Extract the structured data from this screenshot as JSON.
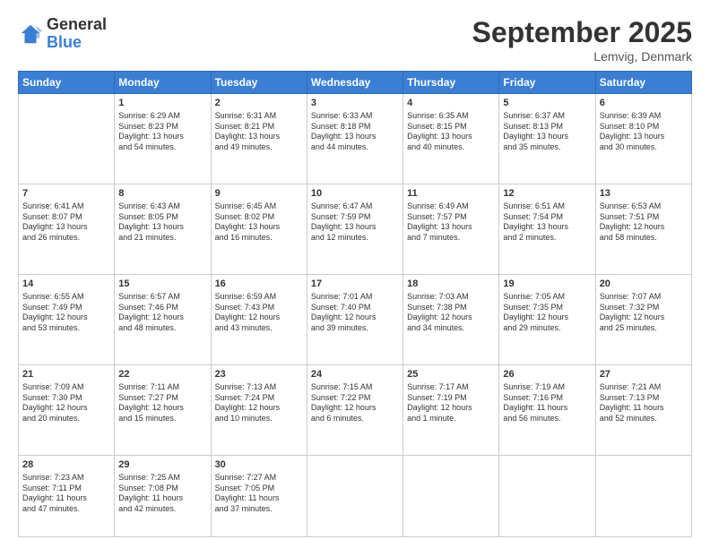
{
  "header": {
    "logo_general": "General",
    "logo_blue": "Blue",
    "month_title": "September 2025",
    "location": "Lemvig, Denmark"
  },
  "days_of_week": [
    "Sunday",
    "Monday",
    "Tuesday",
    "Wednesday",
    "Thursday",
    "Friday",
    "Saturday"
  ],
  "weeks": [
    [
      {
        "day": "",
        "content": ""
      },
      {
        "day": "1",
        "content": "Sunrise: 6:29 AM\nSunset: 8:23 PM\nDaylight: 13 hours\nand 54 minutes."
      },
      {
        "day": "2",
        "content": "Sunrise: 6:31 AM\nSunset: 8:21 PM\nDaylight: 13 hours\nand 49 minutes."
      },
      {
        "day": "3",
        "content": "Sunrise: 6:33 AM\nSunset: 8:18 PM\nDaylight: 13 hours\nand 44 minutes."
      },
      {
        "day": "4",
        "content": "Sunrise: 6:35 AM\nSunset: 8:15 PM\nDaylight: 13 hours\nand 40 minutes."
      },
      {
        "day": "5",
        "content": "Sunrise: 6:37 AM\nSunset: 8:13 PM\nDaylight: 13 hours\nand 35 minutes."
      },
      {
        "day": "6",
        "content": "Sunrise: 6:39 AM\nSunset: 8:10 PM\nDaylight: 13 hours\nand 30 minutes."
      }
    ],
    [
      {
        "day": "7",
        "content": "Sunrise: 6:41 AM\nSunset: 8:07 PM\nDaylight: 13 hours\nand 26 minutes."
      },
      {
        "day": "8",
        "content": "Sunrise: 6:43 AM\nSunset: 8:05 PM\nDaylight: 13 hours\nand 21 minutes."
      },
      {
        "day": "9",
        "content": "Sunrise: 6:45 AM\nSunset: 8:02 PM\nDaylight: 13 hours\nand 16 minutes."
      },
      {
        "day": "10",
        "content": "Sunrise: 6:47 AM\nSunset: 7:59 PM\nDaylight: 13 hours\nand 12 minutes."
      },
      {
        "day": "11",
        "content": "Sunrise: 6:49 AM\nSunset: 7:57 PM\nDaylight: 13 hours\nand 7 minutes."
      },
      {
        "day": "12",
        "content": "Sunrise: 6:51 AM\nSunset: 7:54 PM\nDaylight: 13 hours\nand 2 minutes."
      },
      {
        "day": "13",
        "content": "Sunrise: 6:53 AM\nSunset: 7:51 PM\nDaylight: 12 hours\nand 58 minutes."
      }
    ],
    [
      {
        "day": "14",
        "content": "Sunrise: 6:55 AM\nSunset: 7:49 PM\nDaylight: 12 hours\nand 53 minutes."
      },
      {
        "day": "15",
        "content": "Sunrise: 6:57 AM\nSunset: 7:46 PM\nDaylight: 12 hours\nand 48 minutes."
      },
      {
        "day": "16",
        "content": "Sunrise: 6:59 AM\nSunset: 7:43 PM\nDaylight: 12 hours\nand 43 minutes."
      },
      {
        "day": "17",
        "content": "Sunrise: 7:01 AM\nSunset: 7:40 PM\nDaylight: 12 hours\nand 39 minutes."
      },
      {
        "day": "18",
        "content": "Sunrise: 7:03 AM\nSunset: 7:38 PM\nDaylight: 12 hours\nand 34 minutes."
      },
      {
        "day": "19",
        "content": "Sunrise: 7:05 AM\nSunset: 7:35 PM\nDaylight: 12 hours\nand 29 minutes."
      },
      {
        "day": "20",
        "content": "Sunrise: 7:07 AM\nSunset: 7:32 PM\nDaylight: 12 hours\nand 25 minutes."
      }
    ],
    [
      {
        "day": "21",
        "content": "Sunrise: 7:09 AM\nSunset: 7:30 PM\nDaylight: 12 hours\nand 20 minutes."
      },
      {
        "day": "22",
        "content": "Sunrise: 7:11 AM\nSunset: 7:27 PM\nDaylight: 12 hours\nand 15 minutes."
      },
      {
        "day": "23",
        "content": "Sunrise: 7:13 AM\nSunset: 7:24 PM\nDaylight: 12 hours\nand 10 minutes."
      },
      {
        "day": "24",
        "content": "Sunrise: 7:15 AM\nSunset: 7:22 PM\nDaylight: 12 hours\nand 6 minutes."
      },
      {
        "day": "25",
        "content": "Sunrise: 7:17 AM\nSunset: 7:19 PM\nDaylight: 12 hours\nand 1 minute."
      },
      {
        "day": "26",
        "content": "Sunrise: 7:19 AM\nSunset: 7:16 PM\nDaylight: 11 hours\nand 56 minutes."
      },
      {
        "day": "27",
        "content": "Sunrise: 7:21 AM\nSunset: 7:13 PM\nDaylight: 11 hours\nand 52 minutes."
      }
    ],
    [
      {
        "day": "28",
        "content": "Sunrise: 7:23 AM\nSunset: 7:11 PM\nDaylight: 11 hours\nand 47 minutes."
      },
      {
        "day": "29",
        "content": "Sunrise: 7:25 AM\nSunset: 7:08 PM\nDaylight: 11 hours\nand 42 minutes."
      },
      {
        "day": "30",
        "content": "Sunrise: 7:27 AM\nSunset: 7:05 PM\nDaylight: 11 hours\nand 37 minutes."
      },
      {
        "day": "",
        "content": ""
      },
      {
        "day": "",
        "content": ""
      },
      {
        "day": "",
        "content": ""
      },
      {
        "day": "",
        "content": ""
      }
    ]
  ]
}
